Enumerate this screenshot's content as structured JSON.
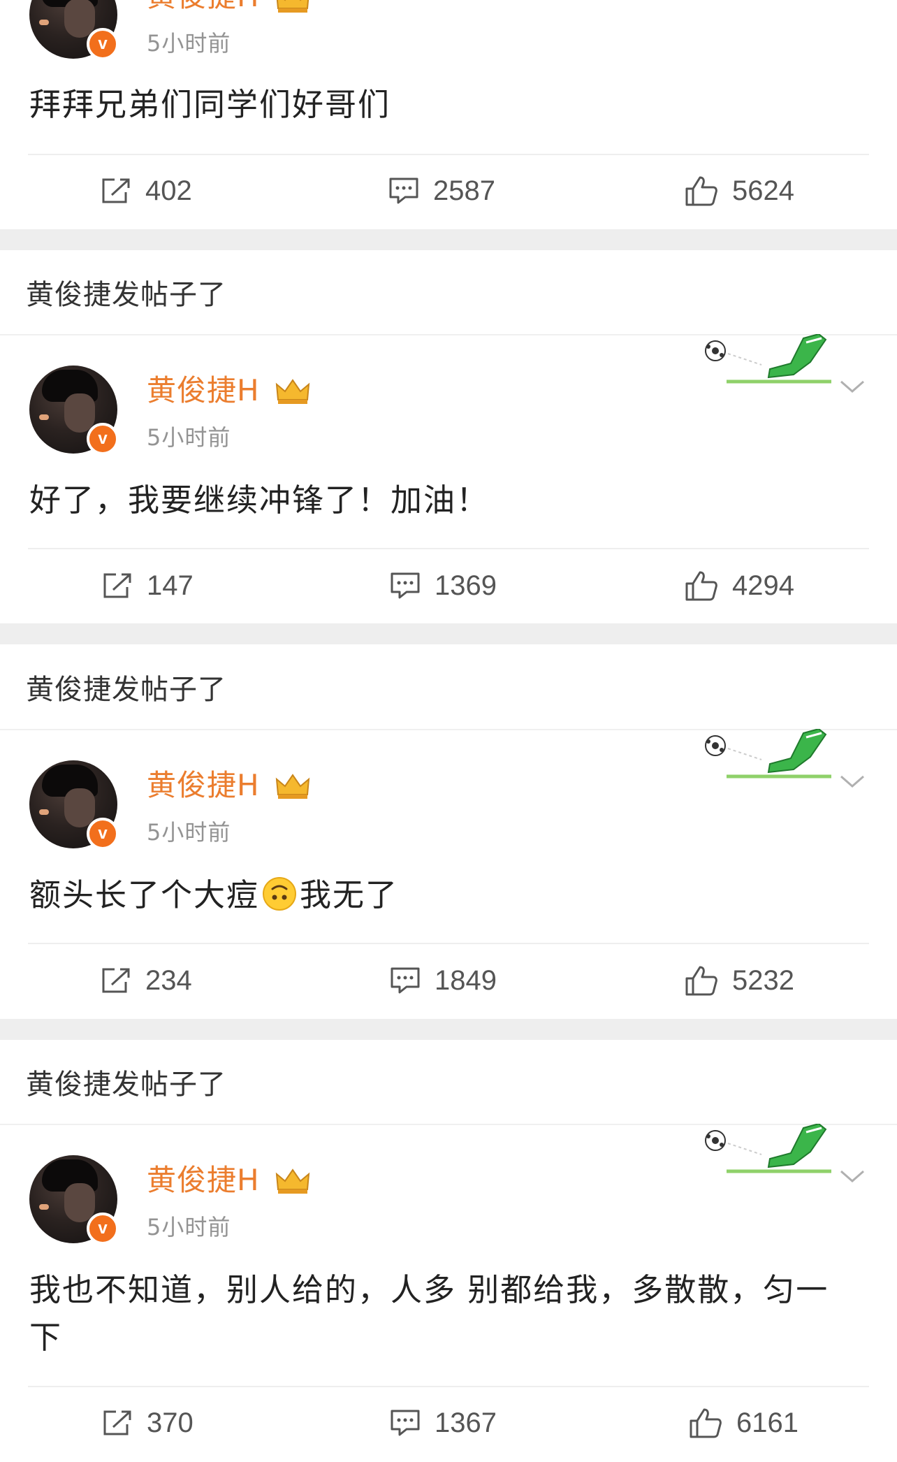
{
  "posts": [
    {
      "section_title": "",
      "username": "黄俊捷H",
      "timestamp": "5小时前",
      "content": "拜拜兄弟们同学们好哥们",
      "reposts": "402",
      "comments": "2587",
      "likes": "5624"
    },
    {
      "section_title": "黄俊捷发帖子了",
      "username": "黄俊捷H",
      "timestamp": "5小时前",
      "content": "好了，我要继续冲锋了！加油！",
      "reposts": "147",
      "comments": "1369",
      "likes": "4294"
    },
    {
      "section_title": "黄俊捷发帖子了",
      "username": "黄俊捷H",
      "timestamp": "5小时前",
      "content_before": "额头长了个大痘",
      "content_after": "我无了",
      "emoji": "upside-down-face",
      "reposts": "234",
      "comments": "1849",
      "likes": "5232"
    },
    {
      "section_title": "黄俊捷发帖子了",
      "username": "黄俊捷H",
      "timestamp": "5小时前",
      "content": "我也不知道，别人给的，人多 别都给我，多散散，匀一下",
      "reposts": "370",
      "comments": "1367",
      "likes": "6161"
    }
  ],
  "icons": {
    "repost": "share-icon",
    "comment": "comment-icon",
    "like": "thumbs-up-icon",
    "verified": "verified-badge-icon",
    "crown": "crown-icon",
    "decoration": "soccer-kick-icon",
    "more": "chevron-down-icon"
  },
  "colors": {
    "username": "#eb7d2e",
    "verified_badge": "#f26f1c",
    "timestamp": "#939393",
    "separator": "#eeeeee"
  }
}
